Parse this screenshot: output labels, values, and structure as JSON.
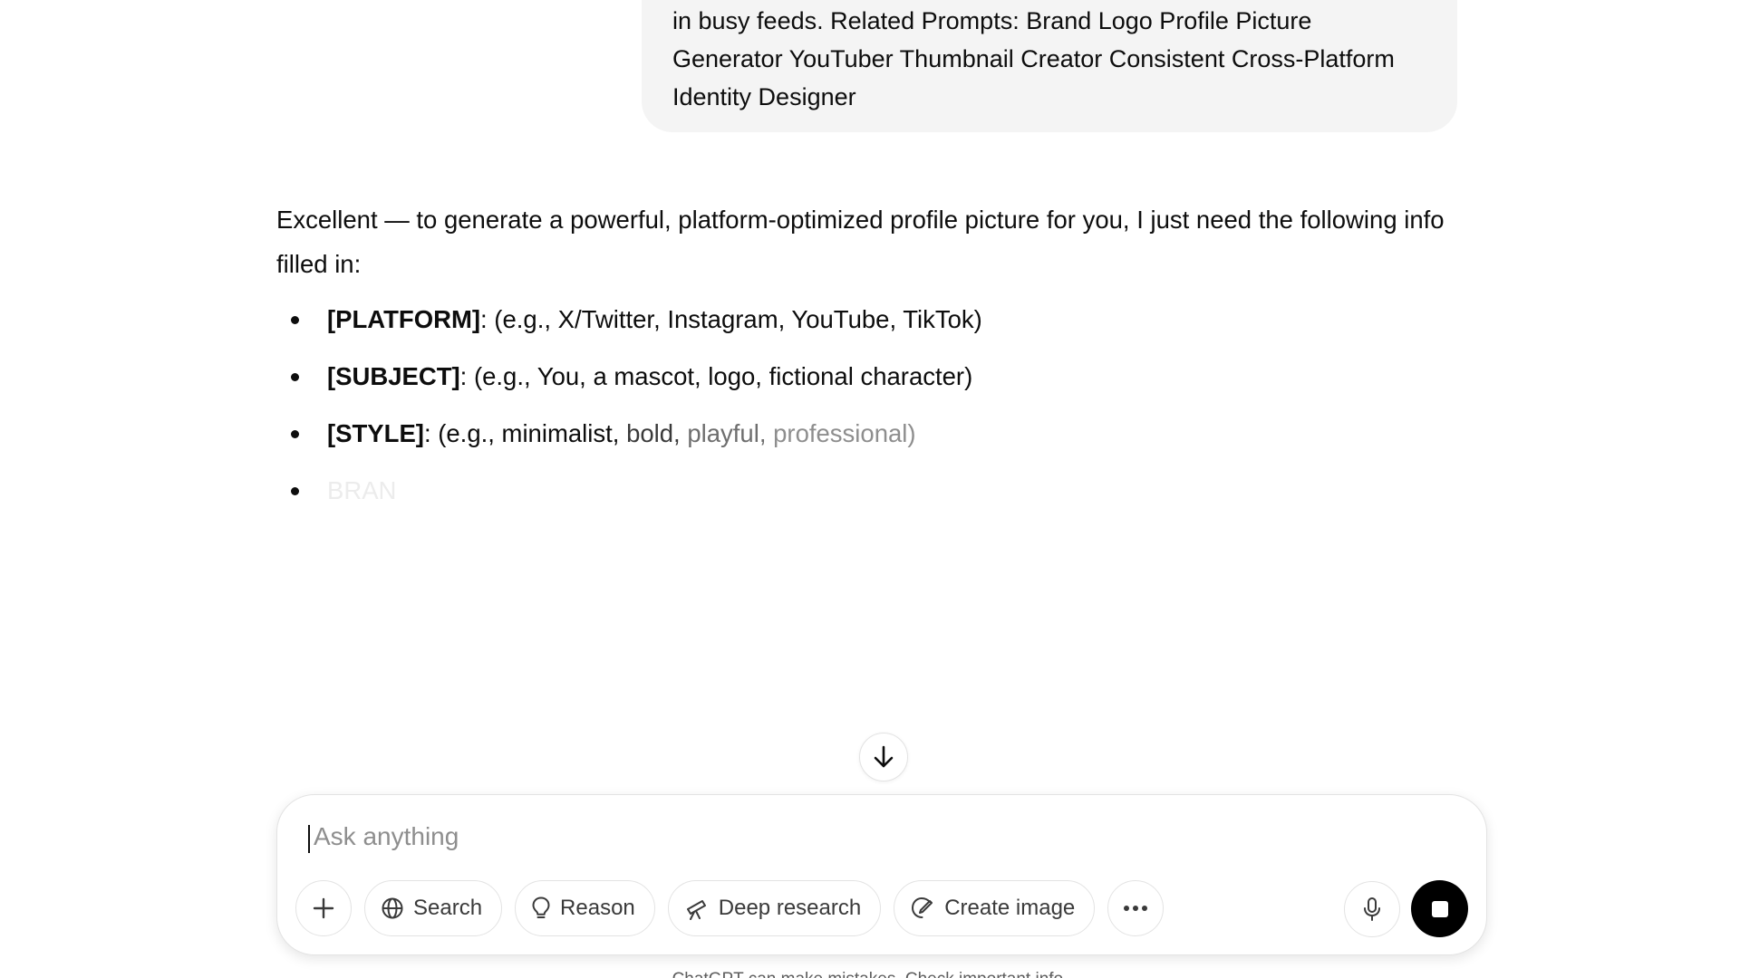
{
  "user_message": {
    "lines": [
      "in busy feeds. Related Prompts:  Brand Logo Profile Picture",
      "Generator YouTuber Thumbnail Creator Consistent Cross-Platform",
      "Identity Designer"
    ]
  },
  "assistant_message": {
    "intro": "Excellent — to generate a powerful, platform-optimized profile picture for you, I just need the following info filled in:",
    "bullets": [
      {
        "key": "[PLATFORM]",
        "text": ": (e.g., X/Twitter, Instagram, YouTube, TikTok)"
      },
      {
        "key": "[SUBJECT]",
        "text": ": (e.g., You, a mascot, logo, fictional character)"
      },
      {
        "key": "[STYLE]",
        "text_a": ": (e.g., minimalist, ",
        "text_b": "bold, ",
        "text_c": "playful, ",
        "text_d": "professional)"
      },
      {
        "key": "BRAN",
        "text": ""
      }
    ]
  },
  "scroll_button": {
    "icon": "arrow-down-icon"
  },
  "composer": {
    "placeholder": "Ask anything",
    "value": "",
    "buttons": {
      "add": "plus-icon",
      "search": "Search",
      "reason": "Reason",
      "deep_research": "Deep research",
      "create_image": "Create image",
      "more": "ellipsis-icon",
      "voice": "microphone-icon",
      "stop": "stop-icon"
    }
  },
  "disclaimer": "ChatGPT can make mistakes. Check important info."
}
